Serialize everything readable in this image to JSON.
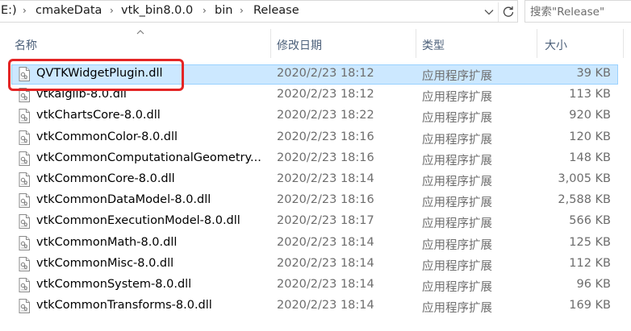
{
  "address": {
    "crumbs": [
      "E:)",
      "cmakeData",
      "vtk_bin8.0.0",
      "bin",
      "Release"
    ]
  },
  "search": {
    "placeholder": "搜索\"Release\""
  },
  "columns": {
    "name": "名称",
    "date": "修改日期",
    "type": "类型",
    "size": "大小"
  },
  "files": [
    {
      "name": "QVTKWidgetPlugin.dll",
      "date": "2020/2/23 18:12",
      "type": "应用程序扩展",
      "size": "39 KB",
      "selected": true
    },
    {
      "name": "vtkalglib-8.0.dll",
      "date": "2020/2/23 18:12",
      "type": "应用程序扩展",
      "size": "113 KB"
    },
    {
      "name": "vtkChartsCore-8.0.dll",
      "date": "2020/2/23 18:22",
      "type": "应用程序扩展",
      "size": "920 KB"
    },
    {
      "name": "vtkCommonColor-8.0.dll",
      "date": "2020/2/23 18:16",
      "type": "应用程序扩展",
      "size": "120 KB"
    },
    {
      "name": "vtkCommonComputationalGeometry...",
      "date": "2020/2/23 18:16",
      "type": "应用程序扩展",
      "size": "148 KB"
    },
    {
      "name": "vtkCommonCore-8.0.dll",
      "date": "2020/2/23 18:14",
      "type": "应用程序扩展",
      "size": "3,005 KB"
    },
    {
      "name": "vtkCommonDataModel-8.0.dll",
      "date": "2020/2/23 18:16",
      "type": "应用程序扩展",
      "size": "2,588 KB"
    },
    {
      "name": "vtkCommonExecutionModel-8.0.dll",
      "date": "2020/2/23 18:17",
      "type": "应用程序扩展",
      "size": "566 KB"
    },
    {
      "name": "vtkCommonMath-8.0.dll",
      "date": "2020/2/23 18:14",
      "type": "应用程序扩展",
      "size": "125 KB"
    },
    {
      "name": "vtkCommonMisc-8.0.dll",
      "date": "2020/2/23 18:14",
      "type": "应用程序扩展",
      "size": "112 KB"
    },
    {
      "name": "vtkCommonSystem-8.0.dll",
      "date": "2020/2/23 18:14",
      "type": "应用程序扩展",
      "size": "96 KB"
    },
    {
      "name": "vtkCommonTransforms-8.0.dll",
      "date": "2020/2/23 18:14",
      "type": "应用程序扩展",
      "size": "169 KB"
    }
  ],
  "icons": {
    "file": "dll-file-icon",
    "dropdown": "chevron-down-icon",
    "refresh": "refresh-icon",
    "sort": "sort-up-icon",
    "separator": "chevron-right-icon"
  },
  "colors": {
    "selection_bg": "#cce8ff",
    "selection_border": "#99d1ff",
    "highlight": "#e42525",
    "header_text": "#4c607a"
  }
}
